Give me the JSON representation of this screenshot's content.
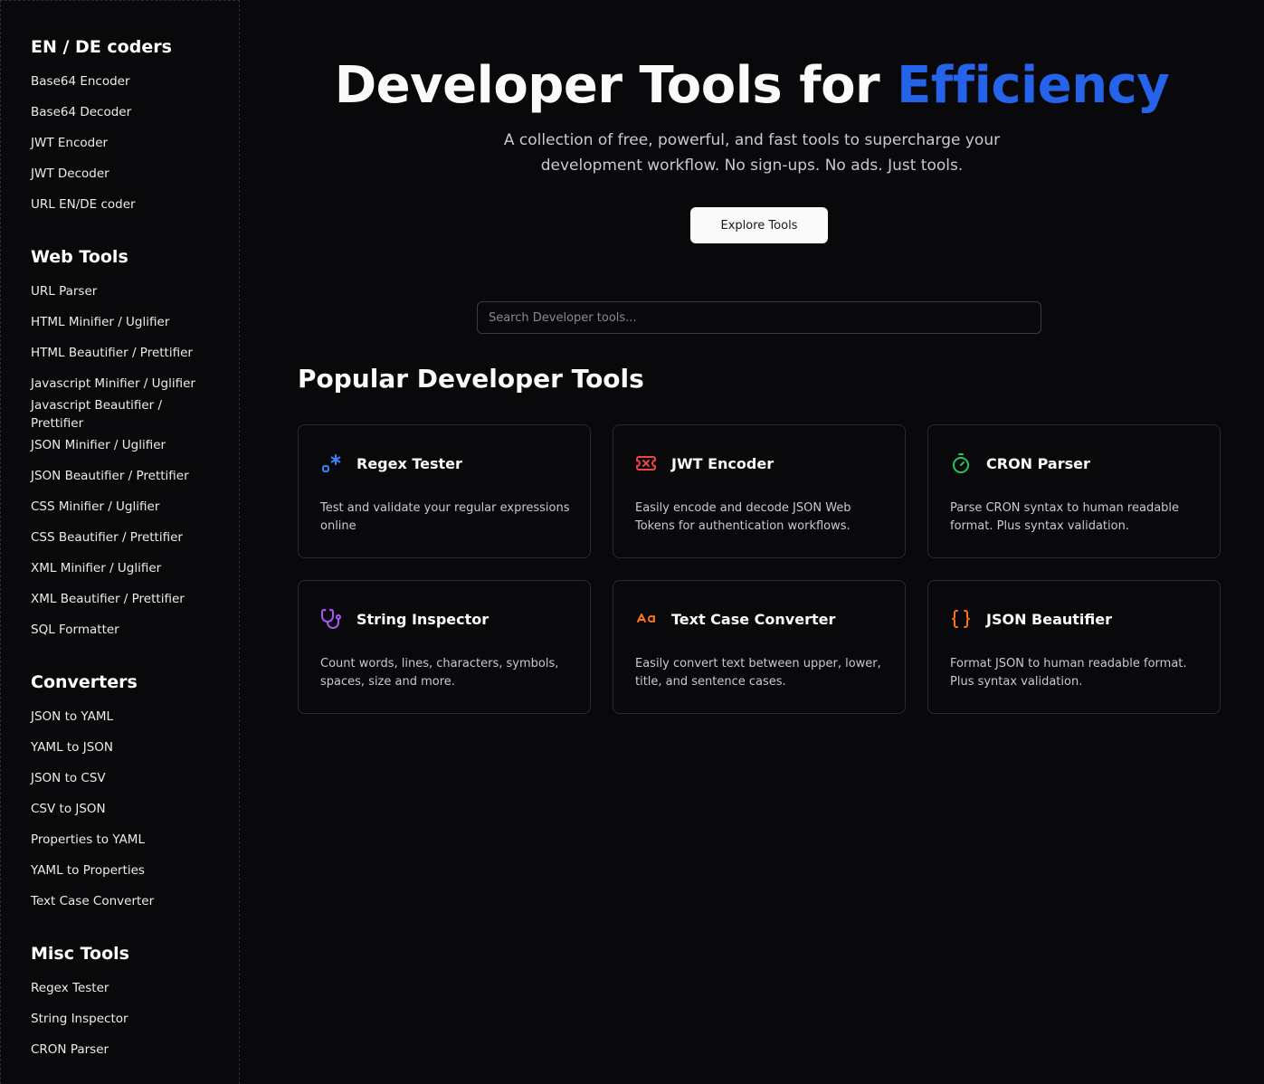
{
  "sidebar": {
    "sections": [
      {
        "heading": "EN / DE coders",
        "items": [
          "Base64 Encoder",
          "Base64 Decoder",
          "JWT Encoder",
          "JWT Decoder",
          "URL EN/DE coder"
        ]
      },
      {
        "heading": "Web Tools",
        "items": [
          "URL Parser",
          "HTML Minifier / Uglifier",
          "HTML Beautifier / Prettifier",
          "Javascript Minifier / Uglifier",
          "Javascript Beautifier / Prettifier",
          "JSON Minifier / Uglifier",
          "JSON Beautifier / Prettifier",
          "CSS Minifier / Uglifier",
          "CSS Beautifier / Prettifier",
          "XML Minifier / Uglifier",
          "XML Beautifier / Prettifier",
          "SQL Formatter"
        ]
      },
      {
        "heading": "Converters",
        "items": [
          "JSON to YAML",
          "YAML to JSON",
          "JSON to CSV",
          "CSV to JSON",
          "Properties to YAML",
          "YAML to Properties",
          "Text Case Converter"
        ]
      },
      {
        "heading": "Misc Tools",
        "items": [
          "Regex Tester",
          "String Inspector",
          "CRON Parser"
        ]
      }
    ]
  },
  "hero": {
    "title_prefix": "Developer Tools for ",
    "title_accent": "Efficiency",
    "subtitle_line1": "A collection of free, powerful, and fast tools to supercharge your",
    "subtitle_line2": "development workflow. No sign-ups. No ads. Just tools.",
    "cta_label": "Explore Tools"
  },
  "search": {
    "placeholder": "Search Developer tools..."
  },
  "popular": {
    "title": "Popular Developer Tools",
    "cards": [
      {
        "title": "Regex Tester",
        "description": "Test and validate your regular expressions online",
        "icon": "regex-icon",
        "color": "#3b82f6"
      },
      {
        "title": "JWT Encoder",
        "description": "Easily encode and decode JSON Web Tokens for authentication workflows.",
        "icon": "ticket-icon",
        "color": "#ef4444"
      },
      {
        "title": "CRON Parser",
        "description": "Parse CRON syntax to human readable format. Plus syntax validation.",
        "icon": "timer-icon",
        "color": "#22c55e"
      },
      {
        "title": "String Inspector",
        "description": "Count words, lines, characters, symbols, spaces, size and more.",
        "icon": "stethoscope-icon",
        "color": "#a855f7"
      },
      {
        "title": "Text Case Converter",
        "description": "Easily convert text between upper, lower, title, and sentence cases.",
        "icon": "case-sensitive-icon",
        "color": "#f97316"
      },
      {
        "title": "JSON Beautifier",
        "description": "Format JSON to human readable format. Plus syntax validation.",
        "icon": "braces-icon",
        "color": "#f97316"
      }
    ]
  }
}
